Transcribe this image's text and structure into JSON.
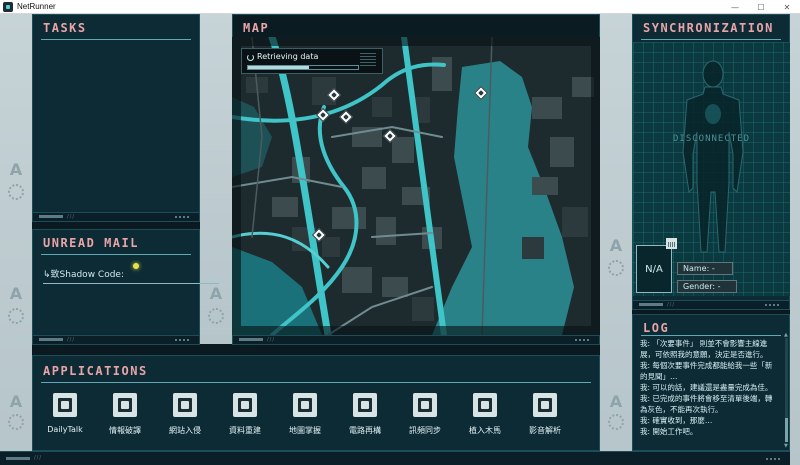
{
  "window": {
    "title": "NetRunner",
    "controls": [
      "—",
      "☐",
      "✕"
    ]
  },
  "tasks": {
    "title": "TASKS"
  },
  "mail": {
    "title": "UNREAD MAIL",
    "item": "↳致Shadow Code:"
  },
  "map": {
    "title": "MAP",
    "loading_text": "Retrieving data",
    "loading_progress": 0.55,
    "pins": [
      "pin-1",
      "pin-2",
      "pin-3",
      "pin-4",
      "pin-5",
      "pin-6"
    ]
  },
  "sync": {
    "title": "SYNCHRONIZATION",
    "status": "DISCONNECTED",
    "avatar_text": "N/A",
    "name_field": "Name: -",
    "gender_field": "Gender: -"
  },
  "log": {
    "title": "LOG",
    "lines": [
      "我: 「次要事件」 則並不會影響主線進展，可依照我的意願，決定是否進行。",
      "我: 每個次要事件完成都能給我一些「新的見聞」…",
      "我: 可以的話，建議還是盡量完成為佳。",
      "我: 已完成的事件將會移至清單後端，轉為灰色，不能再次執行。",
      "我: 確實收到，那麼…",
      "我: 開始工作吧。"
    ]
  },
  "applications": {
    "title": "APPLICATIONS",
    "items": [
      {
        "label": "DailyTalk",
        "icon": "chat-icon"
      },
      {
        "label": "情報破譯",
        "icon": "document-search-icon"
      },
      {
        "label": "網站入侵",
        "icon": "shield-icon"
      },
      {
        "label": "資料重建",
        "icon": "database-gear-icon"
      },
      {
        "label": "地圖掌握",
        "icon": "map-pin-icon"
      },
      {
        "label": "電路再構",
        "icon": "circuit-icon"
      },
      {
        "label": "訊頻同步",
        "icon": "waveform-icon"
      },
      {
        "label": "植入木馬",
        "icon": "virus-icon"
      },
      {
        "label": "影音解析",
        "icon": "frame-icon"
      }
    ]
  },
  "colors": {
    "accent": "#e8a4a6",
    "panel": "#0c2b35",
    "road": "#3fc4c8"
  }
}
